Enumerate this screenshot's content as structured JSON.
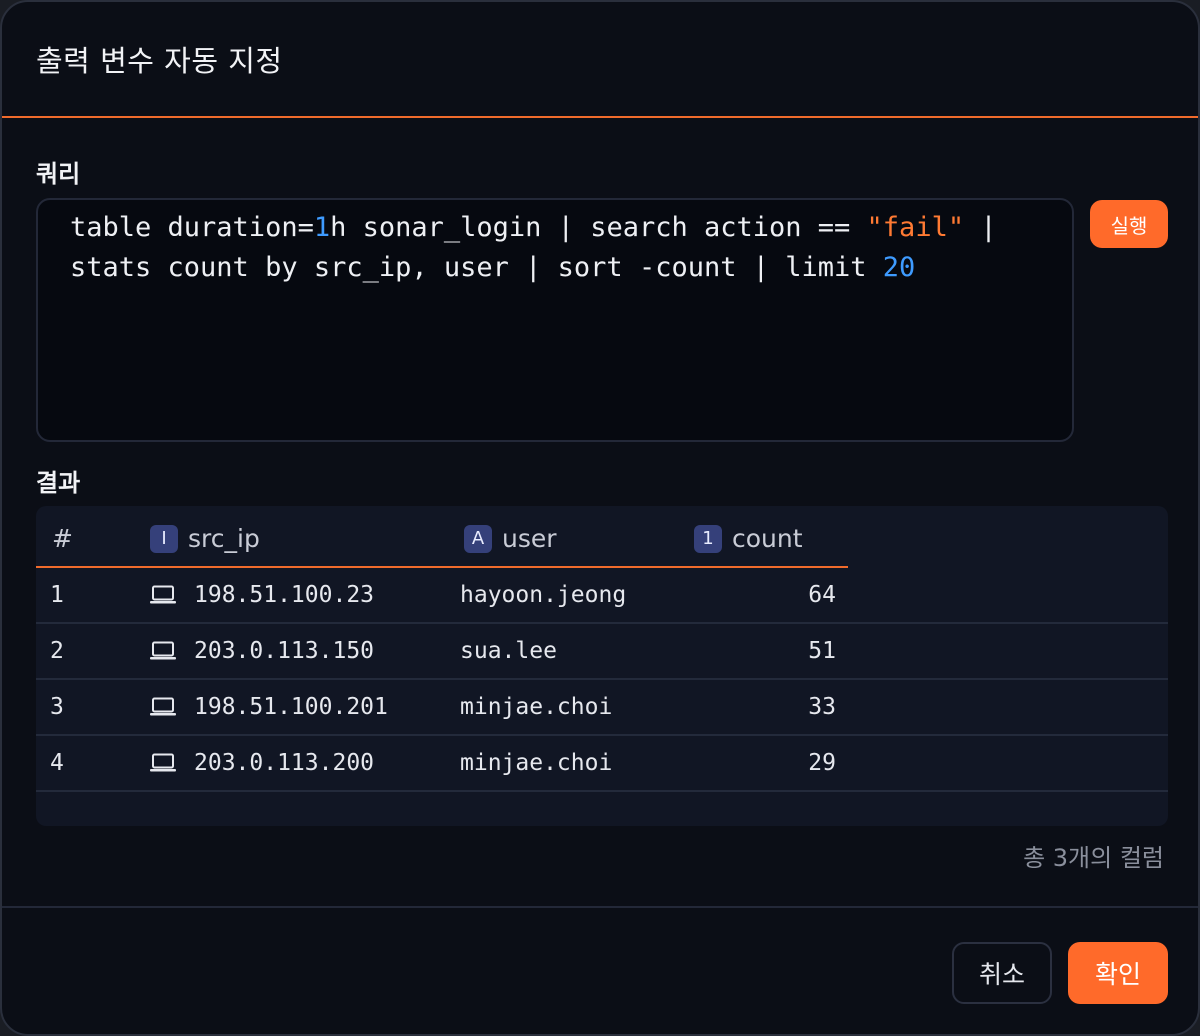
{
  "dialog": {
    "title": "출력 변수 자동 지정"
  },
  "query": {
    "label": "쿼리",
    "line1_a": "table duration=",
    "line1_num": "1",
    "line1_b": "h sonar_login | search action == ",
    "line1_str": "\"fail\"",
    "line1_c": " |",
    "line2_a": "stats count by src_ip, user | sort -count | limit ",
    "line2_num": "20",
    "run_label": "실행"
  },
  "result": {
    "label": "결과",
    "columns": [
      {
        "name": "#",
        "badge": ""
      },
      {
        "name": "src_ip",
        "badge": "I"
      },
      {
        "name": "user",
        "badge": "A"
      },
      {
        "name": "count",
        "badge": "1"
      }
    ],
    "rows": [
      {
        "idx": "1",
        "src_ip": "198.51.100.23",
        "user": "hayoon.jeong",
        "count": "64"
      },
      {
        "idx": "2",
        "src_ip": "203.0.113.150",
        "user": "sua.lee",
        "count": "51"
      },
      {
        "idx": "3",
        "src_ip": "198.51.100.201",
        "user": "minjae.choi",
        "count": "33"
      },
      {
        "idx": "4",
        "src_ip": "203.0.113.200",
        "user": "minjae.choi",
        "count": "29"
      }
    ],
    "summary": "총 3개의 컬럼"
  },
  "footer": {
    "cancel_label": "취소",
    "ok_label": "확인"
  },
  "colors": {
    "accent": "#ff6a2a",
    "number": "#3e9bff",
    "background": "#0b0e16"
  },
  "icons": {
    "ip_cell": "laptop-icon"
  }
}
